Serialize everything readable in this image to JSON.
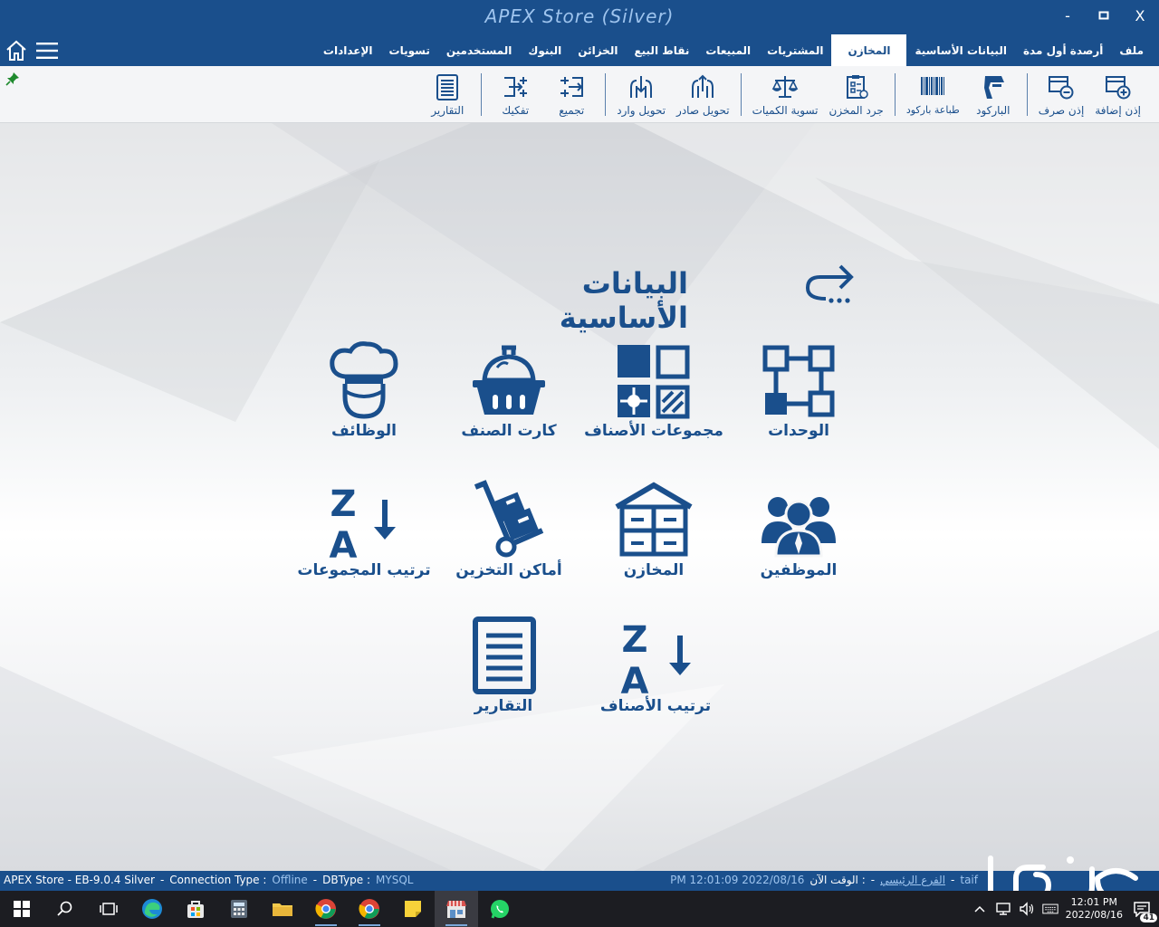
{
  "window": {
    "title": "APEX Store (Silver)",
    "controls": {
      "minimize": "-",
      "maximize": "□",
      "close": "X"
    }
  },
  "menu": {
    "tabs": [
      {
        "label": "ملف"
      },
      {
        "label": "أرصدة أول مدة"
      },
      {
        "label": "البيانات الأساسية"
      },
      {
        "label": "المخازن",
        "active": true
      },
      {
        "label": "المشتريات"
      },
      {
        "label": "المبيعات"
      },
      {
        "label": "نقاط البيع"
      },
      {
        "label": "الخزائن"
      },
      {
        "label": "البنوك"
      },
      {
        "label": "المستخدمين"
      },
      {
        "label": "تسويات"
      },
      {
        "label": "الإعدادات"
      }
    ]
  },
  "ribbon": {
    "items": [
      {
        "label": "إذن إضافة",
        "icon": "add-permit-icon"
      },
      {
        "label": "إذن صرف",
        "icon": "issue-permit-icon"
      },
      {
        "label": "الباركود",
        "icon": "barcode-scanner-icon"
      },
      {
        "label": "طباعة باركود",
        "icon": "barcode-icon"
      },
      {
        "label": "جرد المخزن",
        "icon": "inventory-clipboard-icon"
      },
      {
        "label": "تسوية الكميات",
        "icon": "scale-icon"
      },
      {
        "label": "تحويل صادر",
        "icon": "outgoing-transfer-icon"
      },
      {
        "label": "تحويل وارد",
        "icon": "incoming-transfer-icon"
      },
      {
        "label": "تجميع",
        "icon": "assemble-icon"
      },
      {
        "label": "تفكيك",
        "icon": "disassemble-icon"
      },
      {
        "label": "التقارير",
        "icon": "report-icon"
      }
    ]
  },
  "main": {
    "title": "البيانات الأساسية",
    "tiles": [
      {
        "label": "الوحدات",
        "icon": "units-icon"
      },
      {
        "label": "مجموعات الأصناف",
        "icon": "item-groups-icon"
      },
      {
        "label": "كارت الصنف",
        "icon": "basket-icon"
      },
      {
        "label": "الوظائف",
        "icon": "chef-icon"
      },
      {
        "label": "الموظفين",
        "icon": "employees-icon"
      },
      {
        "label": "المخازن",
        "icon": "warehouse-icon"
      },
      {
        "label": "أماكن التخزين",
        "icon": "hand-truck-icon"
      },
      {
        "label": "ترتيب المجموعات",
        "icon": "sort-za-icon"
      },
      {
        "label": "ترتيب الأصناف",
        "icon": "sort-za-icon"
      },
      {
        "label": "التقارير",
        "icon": "report-icon"
      }
    ]
  },
  "status": {
    "app": "APEX Store - EB-9.0.4 Silver",
    "connection_label": "Connection Type :",
    "connection_value": "Offline",
    "dbtype_label": "DBType :",
    "dbtype_value": "MYSQL",
    "datetime": "PM 12:01:09 2022/08/16",
    "now_label": "الوقت الآن :",
    "branch": "الفرع الرئيسي",
    "city": "taif",
    "sep": "-"
  },
  "taskbar": {
    "clock_time": "12:01 PM",
    "clock_date": "2022/08/16",
    "notifications": "41"
  },
  "watermark": {
    "text": "حراج"
  },
  "colors": {
    "brand": "#1a4f8c",
    "accent": "#9ec4ee",
    "taskbar": "#1c1d22"
  }
}
